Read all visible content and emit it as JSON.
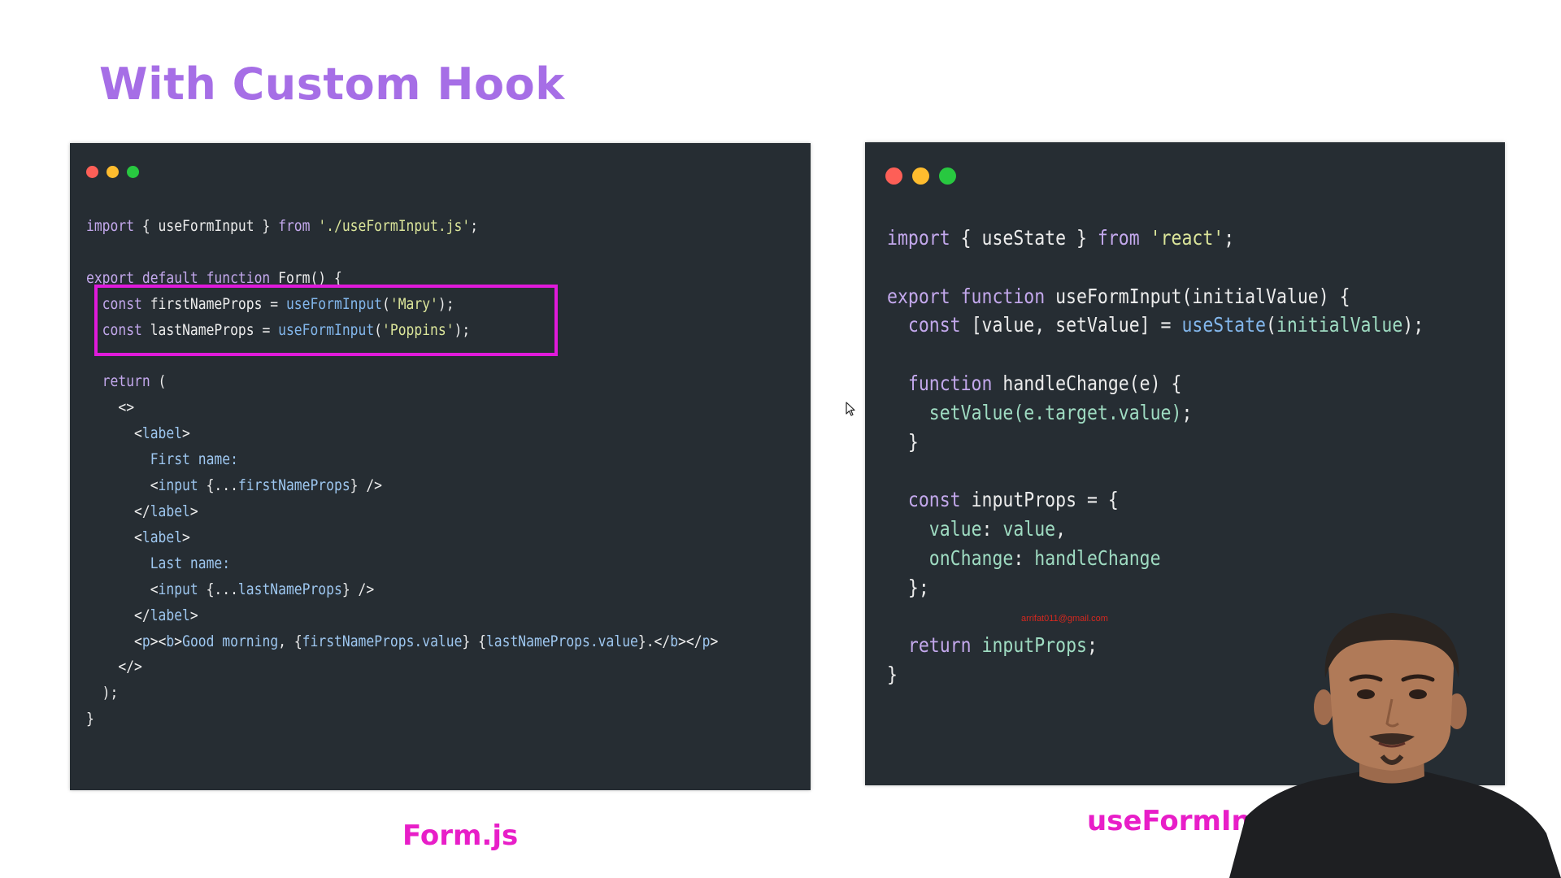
{
  "slide": {
    "title": "With Custom Hook"
  },
  "panel_left": {
    "caption": "Form.js",
    "lines": [
      [
        [
          "kw",
          "import"
        ],
        [
          "plain",
          " { useFormInput } "
        ],
        [
          "kw",
          "from"
        ],
        [
          "plain",
          " "
        ],
        [
          "str",
          "'./useFormInput.js'"
        ],
        [
          "plain",
          ";"
        ]
      ],
      [],
      [
        [
          "kw",
          "export default function"
        ],
        [
          "plain",
          " Form() {"
        ]
      ],
      [
        [
          "plain",
          "  "
        ],
        [
          "kw",
          "const"
        ],
        [
          "plain",
          " firstNameProps = "
        ],
        [
          "fn",
          "useFormInput"
        ],
        [
          "plain",
          "("
        ],
        [
          "str",
          "'Mary'"
        ],
        [
          "plain",
          ");"
        ]
      ],
      [
        [
          "plain",
          "  "
        ],
        [
          "kw",
          "const"
        ],
        [
          "plain",
          " lastNameProps = "
        ],
        [
          "fn",
          "useFormInput"
        ],
        [
          "plain",
          "("
        ],
        [
          "str",
          "'Poppins'"
        ],
        [
          "plain",
          ");"
        ]
      ],
      [],
      [
        [
          "plain",
          "  "
        ],
        [
          "kw",
          "return"
        ],
        [
          "plain",
          " ("
        ]
      ],
      [
        [
          "plain",
          "    <>"
        ]
      ],
      [
        [
          "plain",
          "      <"
        ],
        [
          "tag",
          "label"
        ],
        [
          "plain",
          ">"
        ]
      ],
      [
        [
          "plain",
          "        "
        ],
        [
          "tag",
          "First name:"
        ]
      ],
      [
        [
          "plain",
          "        <"
        ],
        [
          "tag",
          "input"
        ],
        [
          "plain",
          " {..."
        ],
        [
          "tag",
          "firstNameProps"
        ],
        [
          "plain",
          "} />"
        ]
      ],
      [
        [
          "plain",
          "      </"
        ],
        [
          "tag",
          "label"
        ],
        [
          "plain",
          ">"
        ]
      ],
      [
        [
          "plain",
          "      <"
        ],
        [
          "tag",
          "label"
        ],
        [
          "plain",
          ">"
        ]
      ],
      [
        [
          "plain",
          "        "
        ],
        [
          "tag",
          "Last name:"
        ]
      ],
      [
        [
          "plain",
          "        <"
        ],
        [
          "tag",
          "input"
        ],
        [
          "plain",
          " {..."
        ],
        [
          "tag",
          "lastNameProps"
        ],
        [
          "plain",
          "} />"
        ]
      ],
      [
        [
          "plain",
          "      </"
        ],
        [
          "tag",
          "label"
        ],
        [
          "plain",
          ">"
        ]
      ],
      [
        [
          "plain",
          "      <"
        ],
        [
          "tag",
          "p"
        ],
        [
          "plain",
          "><"
        ],
        [
          "tag",
          "b"
        ],
        [
          "plain",
          ">"
        ],
        [
          "tag",
          "Good morning"
        ],
        [
          "plain",
          ", {"
        ],
        [
          "tag",
          "firstNameProps.value"
        ],
        [
          "plain",
          "} {"
        ],
        [
          "tag",
          "lastNameProps.value"
        ],
        [
          "plain",
          "}.</"
        ],
        [
          "tag",
          "b"
        ],
        [
          "plain",
          "></"
        ],
        [
          "tag",
          "p"
        ],
        [
          "plain",
          ">"
        ]
      ],
      [
        [
          "plain",
          "    </>"
        ]
      ],
      [
        [
          "plain",
          "  );"
        ]
      ],
      [
        [
          "plain",
          "}"
        ]
      ]
    ]
  },
  "panel_right": {
    "caption": "useFormInput",
    "lines": [
      [
        [
          "kw",
          "import"
        ],
        [
          "plain",
          " { useState } "
        ],
        [
          "kw",
          "from"
        ],
        [
          "plain",
          " "
        ],
        [
          "str",
          "'react'"
        ],
        [
          "plain",
          ";"
        ]
      ],
      [],
      [
        [
          "kw",
          "export function"
        ],
        [
          "plain",
          " useFormInput(initialValue) {"
        ]
      ],
      [
        [
          "plain",
          "  "
        ],
        [
          "kw",
          "const"
        ],
        [
          "plain",
          " [value, setValue] = "
        ],
        [
          "fn",
          "useState"
        ],
        [
          "plain",
          "("
        ],
        [
          "prop",
          "initialValue"
        ],
        [
          "plain",
          ");"
        ]
      ],
      [],
      [
        [
          "plain",
          "  "
        ],
        [
          "kw",
          "function"
        ],
        [
          "plain",
          " handleChange(e) {"
        ]
      ],
      [
        [
          "plain",
          "    "
        ],
        [
          "prop",
          "setValue(e.target.value)"
        ],
        [
          "plain",
          ";"
        ]
      ],
      [
        [
          "plain",
          "  }"
        ]
      ],
      [],
      [
        [
          "plain",
          "  "
        ],
        [
          "kw",
          "const"
        ],
        [
          "plain",
          " inputProps = {"
        ]
      ],
      [
        [
          "plain",
          "    "
        ],
        [
          "prop",
          "value"
        ],
        [
          "plain",
          ": "
        ],
        [
          "prop",
          "value"
        ],
        [
          "plain",
          ","
        ]
      ],
      [
        [
          "plain",
          "    "
        ],
        [
          "prop",
          "onChange"
        ],
        [
          "plain",
          ": "
        ],
        [
          "prop",
          "handleChange"
        ]
      ],
      [
        [
          "plain",
          "  };"
        ]
      ],
      [],
      [
        [
          "plain",
          "  "
        ],
        [
          "kw",
          "return"
        ],
        [
          "plain",
          " "
        ],
        [
          "prop",
          "inputProps"
        ],
        [
          "plain",
          ";"
        ]
      ],
      [
        [
          "plain",
          "}"
        ]
      ]
    ],
    "watermark_email": "arrifat011@gmail.com"
  },
  "colors": {
    "title": "#a66ee6",
    "caption": "#e81ec8",
    "highlight": "#e01adb",
    "panel_bg": "#262d33",
    "keyword": "#c3a8ec",
    "function_call": "#83b7ec",
    "string": "#dbe59a",
    "tag": "#9ec7f0",
    "property": "#9fdcc2"
  },
  "icons": {
    "cursor": "mouse-pointer-icon",
    "window_controls": [
      "close-dot-icon",
      "minimize-dot-icon",
      "maximize-dot-icon"
    ]
  }
}
